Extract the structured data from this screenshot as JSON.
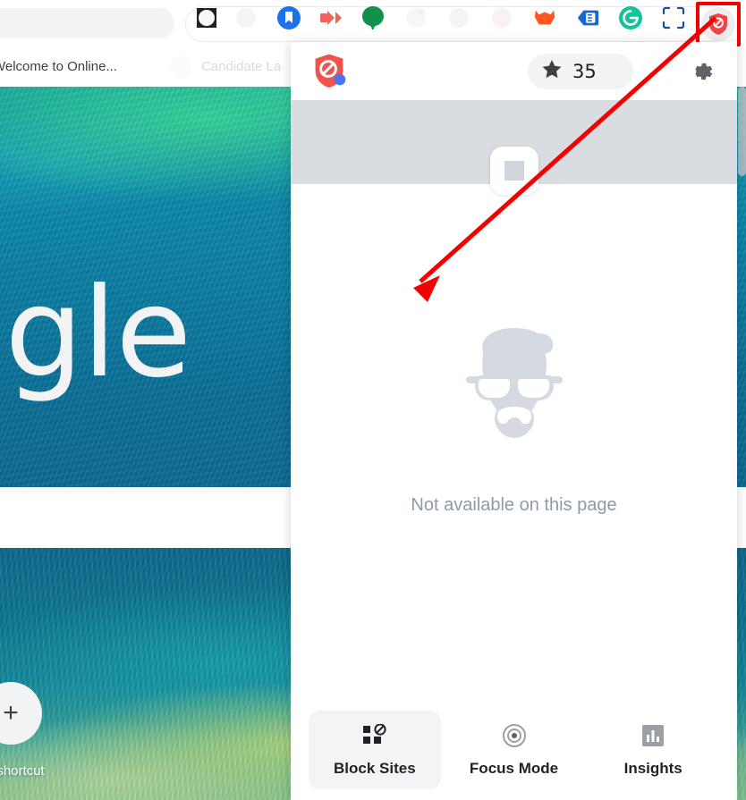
{
  "browser": {
    "omnibox": {
      "name": "address-bar",
      "value": ""
    },
    "extensions": [
      {
        "name": "extension-icon-1",
        "label": "",
        "state": "normal"
      },
      {
        "name": "extension-icon-2",
        "label": "",
        "state": "faded"
      },
      {
        "name": "bookmark-extension",
        "label": "",
        "state": "normal"
      },
      {
        "name": "video-extension",
        "label": "",
        "state": "normal"
      },
      {
        "name": "chat-extension",
        "label": "",
        "state": "normal"
      },
      {
        "name": "extension-icon-6",
        "label": "",
        "state": "faded"
      },
      {
        "name": "extension-icon-7",
        "label": "",
        "state": "faded"
      },
      {
        "name": "extension-icon-8",
        "label": "",
        "state": "faded"
      },
      {
        "name": "fox-extension",
        "label": "",
        "state": "normal"
      },
      {
        "name": "tag-extension",
        "label": "",
        "state": "normal"
      },
      {
        "name": "grammarly-extension",
        "label": "",
        "state": "normal"
      },
      {
        "name": "capture-extension",
        "label": "",
        "state": "normal"
      },
      {
        "name": "blocksite-extension",
        "label": "",
        "state": "highlighted"
      }
    ],
    "tabs": [
      {
        "title": "Welcome to Online...",
        "active": true
      },
      {
        "title": "Candidate La",
        "active": false
      }
    ]
  },
  "page": {
    "logo_text": "ogle",
    "shortcut_label": "shortcut",
    "add_shortcut_glyph": "+"
  },
  "popup": {
    "header": {
      "logo_name": "blocksite-shield-logo",
      "star_icon": "star-icon",
      "score": "35",
      "settings_icon": "gear-icon"
    },
    "site_banner": {
      "favicon_placeholder": "favicon-placeholder"
    },
    "body": {
      "illustration": "hipster-face-illustration",
      "message": "Not available on this page"
    },
    "footer": {
      "items": [
        {
          "label": "Block Sites",
          "icon": "block-sites-icon",
          "selected": true
        },
        {
          "label": "Focus Mode",
          "icon": "target-icon",
          "selected": false
        },
        {
          "label": "Insights",
          "icon": "bar-chart-icon",
          "selected": false
        }
      ]
    }
  },
  "annotation": {
    "arrow_color": "#f50000",
    "highlight_color": "#f50000"
  },
  "colors": {
    "brand_red": "#ef4444",
    "shield_red": "#f0524c",
    "accent_blue": "#4a72f5",
    "banner_gray": "#d9dce1",
    "muted_text": "#8d9aaa",
    "selected_nav_bg": "#f3f4f6"
  }
}
